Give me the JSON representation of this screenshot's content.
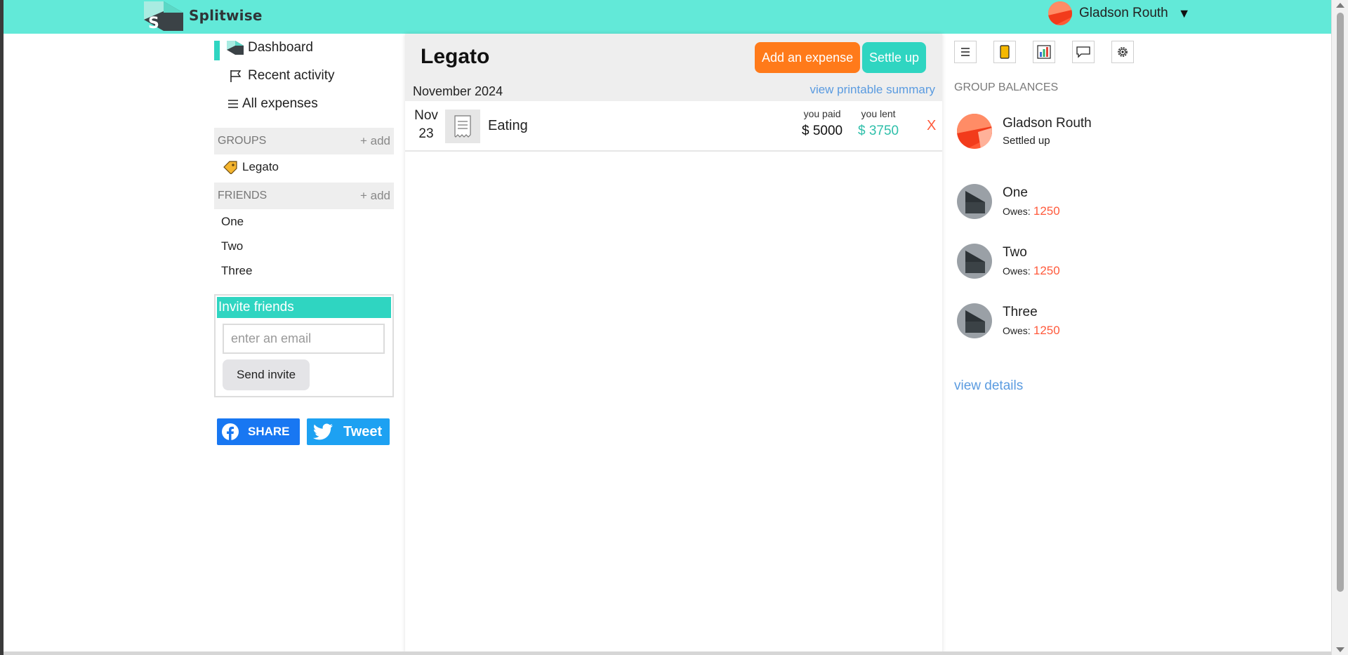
{
  "brand": {
    "name": "Splitwise",
    "accent": "#62e9d8",
    "teal": "#2fd5c1",
    "orange": "#ff7a1a"
  },
  "user": {
    "name": "Gladson Routh",
    "caret": "▼"
  },
  "sidebar": {
    "nav": [
      {
        "label": "Dashboard",
        "icon": "splitwise-logo-icon",
        "active": true
      },
      {
        "label": "Recent activity",
        "icon": "flag-icon"
      },
      {
        "label": "All expenses",
        "icon": "list-icon"
      }
    ],
    "groups_header": "GROUPS",
    "groups_add": "+ add",
    "groups": [
      {
        "label": "Legato",
        "icon": "tag-icon"
      }
    ],
    "friends_header": "FRIENDS",
    "friends_add": "+ add",
    "friends": [
      "One",
      "Two",
      "Three"
    ]
  },
  "invite": {
    "title": "Invite friends",
    "placeholder": "enter an email",
    "button": "Send invite"
  },
  "social": {
    "share": "SHARE",
    "tweet": "Tweet"
  },
  "group": {
    "title": "Legato",
    "add_expense": "Add an expense",
    "settle_up": "Settle up",
    "month": "November 2024",
    "printable": "view printable summary",
    "expenses": [
      {
        "month": "Nov",
        "day": "23",
        "description": "Eating",
        "paid_label": "you paid",
        "paid_value": "$ 5000",
        "lent_label": "you lent",
        "lent_value": "$ 3750",
        "delete": "X"
      }
    ]
  },
  "balances": {
    "header": "GROUP BALANCES",
    "owner": {
      "name": "Gladson Routh",
      "status": "Settled up"
    },
    "members": [
      {
        "name": "One",
        "owes_label": "Owes:",
        "amount": "1250"
      },
      {
        "name": "Two",
        "owes_label": "Owes:",
        "amount": "1250"
      },
      {
        "name": "Three",
        "owes_label": "Owes:",
        "amount": "1250"
      }
    ],
    "view_details": "view details"
  },
  "toolbar_icons": [
    "list-icon",
    "phone-icon",
    "chart-icon",
    "comment-icon",
    "gear-icon"
  ]
}
